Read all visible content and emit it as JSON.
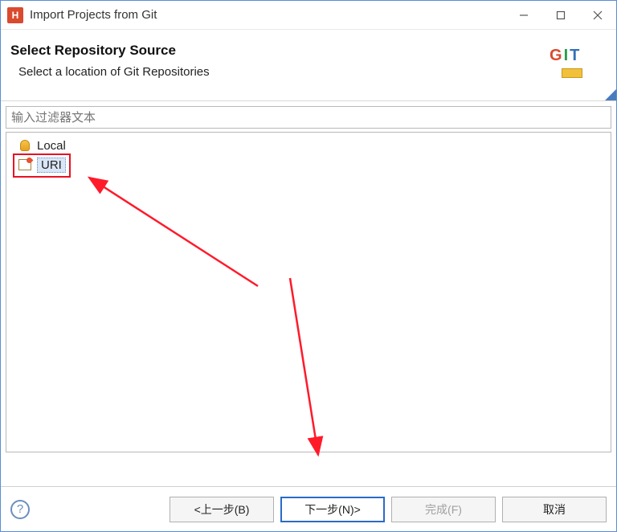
{
  "titlebar": {
    "icon_letter": "H",
    "title": "Import Projects from Git"
  },
  "header": {
    "title": "Select Repository Source",
    "subtitle": "Select a location of Git Repositories",
    "logo_g": "G",
    "logo_i": "I",
    "logo_t": "T"
  },
  "filter": {
    "placeholder": "输入过滤器文本"
  },
  "list": {
    "items": [
      {
        "label": "Local"
      },
      {
        "label": "URI"
      }
    ]
  },
  "footer": {
    "help": "?",
    "back": "<上一步(B)",
    "next": "下一步(N)>",
    "finish": "完成(F)",
    "cancel": "取消"
  }
}
